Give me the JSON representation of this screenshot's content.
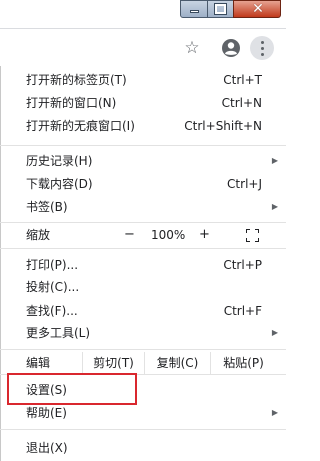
{
  "window": {
    "close_glyph": "✕"
  },
  "toolbar": {
    "star_icon": "☆"
  },
  "menu": {
    "group1": [
      {
        "label": "打开新的标签页(T)",
        "shortcut": "Ctrl+T"
      },
      {
        "label": "打开新的窗口(N)",
        "shortcut": "Ctrl+N"
      },
      {
        "label": "打开新的无痕窗口(I)",
        "shortcut": "Ctrl+Shift+N"
      }
    ],
    "group2": [
      {
        "label": "历史记录(H)",
        "shortcut": "",
        "arrow": "▶"
      },
      {
        "label": "下载内容(D)",
        "shortcut": "Ctrl+J"
      },
      {
        "label": "书签(B)",
        "shortcut": "",
        "arrow": "▶"
      }
    ],
    "zoom": {
      "label": "缩放",
      "minus": "−",
      "value": "100%",
      "plus": "+"
    },
    "group3": [
      {
        "label": "打印(P)...",
        "shortcut": "Ctrl+P"
      },
      {
        "label": "投射(C)..."
      },
      {
        "label": "查找(F)...",
        "shortcut": "Ctrl+F"
      },
      {
        "label": "更多工具(L)",
        "arrow": "▶"
      }
    ],
    "edit": {
      "label": "编辑",
      "cut": "剪切(T)",
      "copy": "复制(C)",
      "paste": "粘贴(P)"
    },
    "settings": {
      "label": "设置(S)"
    },
    "help": {
      "label": "帮助(E)",
      "arrow": "▶"
    },
    "exit": {
      "label": "退出(X)"
    }
  },
  "colors": {
    "highlight_box": "#d9272e",
    "kebab_bg": "#dfe1e5"
  }
}
